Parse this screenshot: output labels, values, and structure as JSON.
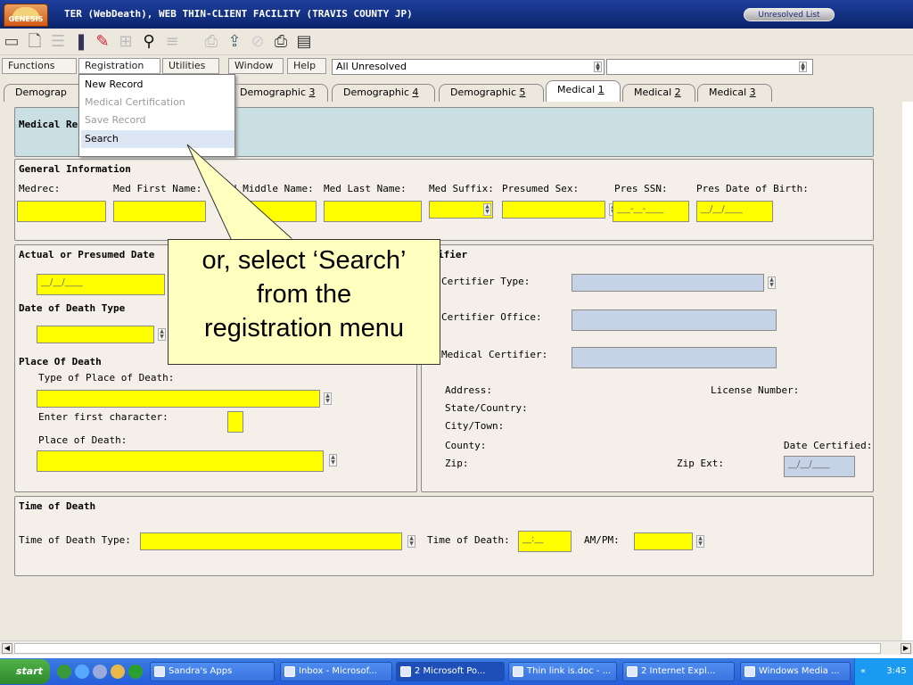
{
  "window": {
    "logo_text": "GENESIS",
    "title": "TER (WebDeath), WEB THIN-CLIENT FACILITY (TRAVIS COUNTY JP)",
    "unresolved_button": "Unresolved List"
  },
  "menubar": {
    "items": [
      "Functions",
      "Registration",
      "Utilities",
      "Window",
      "Help"
    ],
    "filter_value": "All Unresolved",
    "search_value": ""
  },
  "registration_menu": {
    "items": [
      {
        "label": "New Record",
        "enabled": true
      },
      {
        "label": "Medical Certification",
        "enabled": false
      },
      {
        "label": "Save Record",
        "enabled": false
      },
      {
        "label": "Search",
        "enabled": true,
        "highlighted": true
      }
    ]
  },
  "tabs": {
    "t0": "Demograp",
    "t1_prefix": "Demographic ",
    "t1_key": "3",
    "t2_prefix": "Demographic ",
    "t2_key": "4",
    "t3_prefix": "Demographic ",
    "t3_key": "5",
    "t4_prefix": "Medical ",
    "t4_key": "1",
    "t5_prefix": "Medical ",
    "t5_key": "2",
    "t6_prefix": "Medical ",
    "t6_key": "3",
    "active": "Medical 1"
  },
  "medical_record": {
    "title": "Medical Re"
  },
  "general_info": {
    "title": "General Information",
    "medrec": "Medrec:",
    "first": "Med First Name:",
    "middle": "d Middle Name:",
    "last": "Med Last Name:",
    "suffix": "Med Suffix:",
    "sex": "Presumed Sex:",
    "ssn": "Pres SSN:",
    "ssn_mask": "___-__-____",
    "dob": "Pres Date of Birth:",
    "dob_mask": "__/__/____"
  },
  "death_date": {
    "title": "Actual or Presumed Date",
    "date_mask": "__/__/____",
    "type_title": "Date of Death Type"
  },
  "place": {
    "title": "Place Of Death",
    "type_label": "Type of Place of Death:",
    "first_char_label": "Enter first character:",
    "place_label": "Place of Death:"
  },
  "certifier": {
    "title": "ifier",
    "type_label": "Certifier Type:",
    "office_label": "Certifier Office:",
    "medical_label": "Medical Certifier:",
    "address": "Address:",
    "license": "License Number:",
    "state": "State/Country:",
    "city": "City/Town:",
    "county": "County:",
    "date_certified": "Date Certified:",
    "zip": "Zip:",
    "zip_ext": "Zip Ext:",
    "date_mask": "__/__/____"
  },
  "time_of_death": {
    "title": "Time of Death",
    "type_label": "Time of Death Type:",
    "time_label": "Time of Death:",
    "time_mask": "__:__",
    "ampm_label": "AM/PM:"
  },
  "callout": {
    "line1": "or, select ‘Search’",
    "line2": "from the",
    "line3": "registration menu"
  },
  "taskbar": {
    "start": "start",
    "tasks": [
      "Sandra's Apps",
      "Inbox - Microsof...",
      "2 Microsoft Po...",
      "Thin link is.doc - ...",
      "2 Internet Expl...",
      "Windows Media ..."
    ],
    "clock": "3:45"
  },
  "colors": {
    "required_field": "#ffff00",
    "readonly_field": "#c6d2e6",
    "titlebar": "#0a246a",
    "callout": "#ffffc0"
  }
}
